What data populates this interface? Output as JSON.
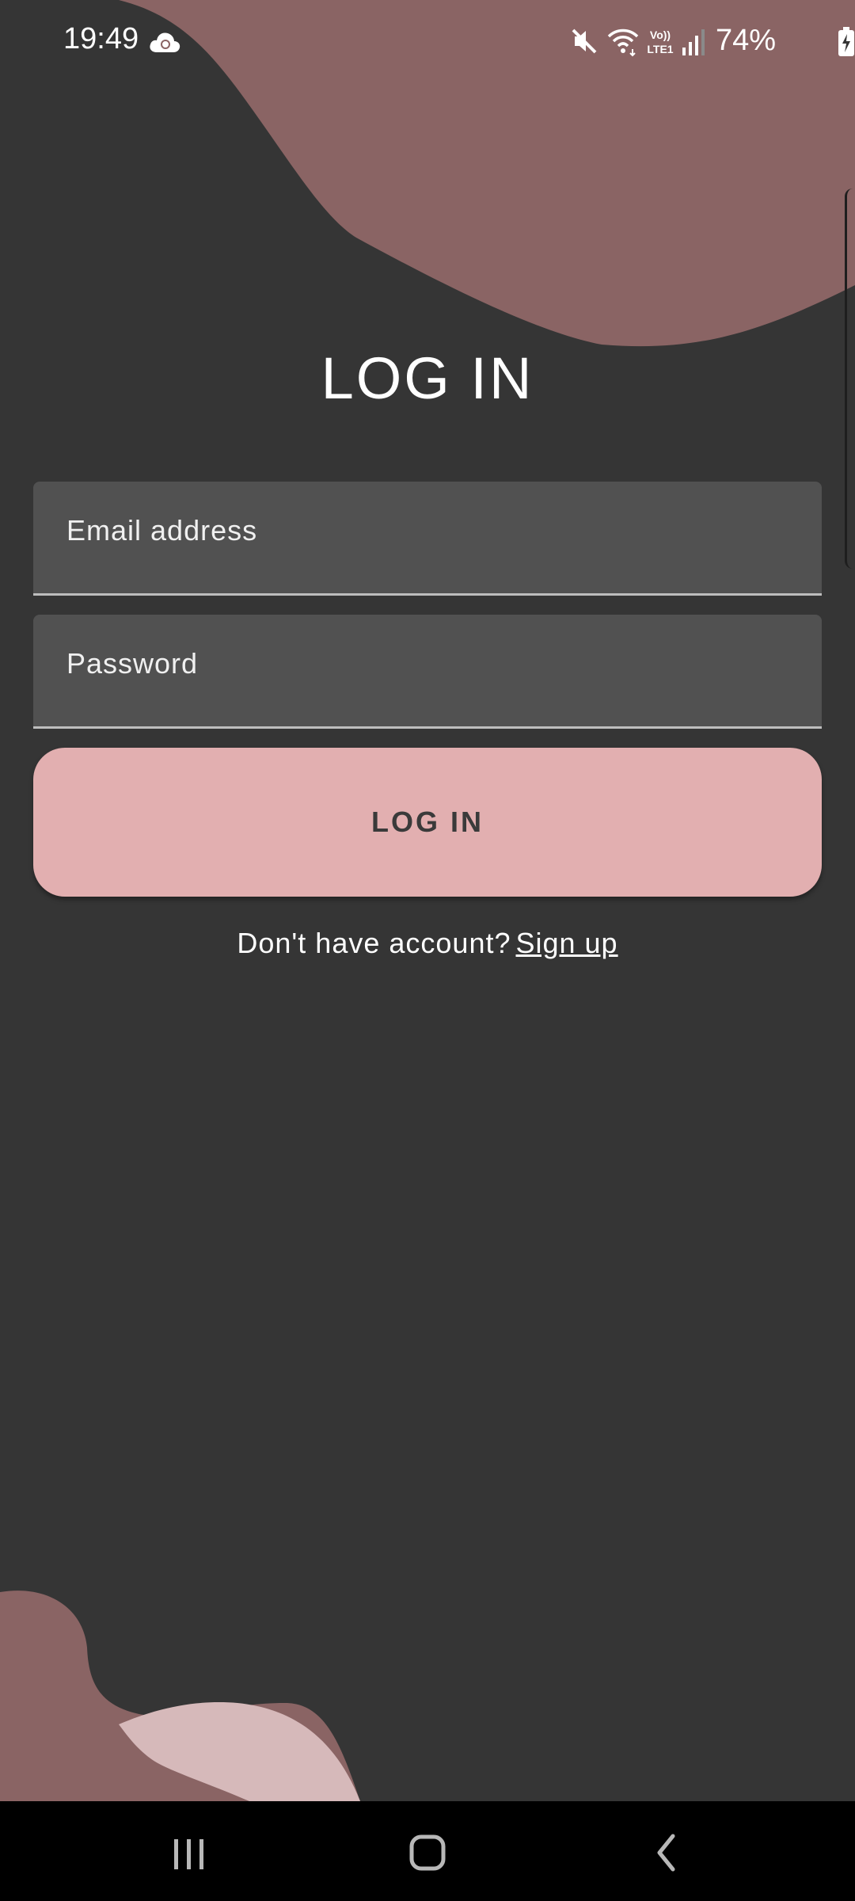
{
  "status_bar": {
    "time": "19:49",
    "battery": "74%",
    "icons": [
      "cloud-sync-icon",
      "mute-icon",
      "wifi-icon",
      "volte-icon",
      "signal-icon",
      "battery-charging-icon"
    ]
  },
  "title": "LOG IN",
  "form": {
    "email_placeholder": "Email address",
    "email_value": "",
    "password_placeholder": "Password",
    "password_value": ""
  },
  "login_button_label": "LOG IN",
  "signup": {
    "prompt": "Don't have account?",
    "link": "Sign up"
  },
  "nav_bar": {
    "icons": [
      "recents-icon",
      "home-icon",
      "back-icon"
    ]
  },
  "colors": {
    "background": "#353535",
    "blob_dark": "#8a6464",
    "blob_light": "#d6b9ba",
    "button": "#e2afb0",
    "field": "#515151"
  }
}
